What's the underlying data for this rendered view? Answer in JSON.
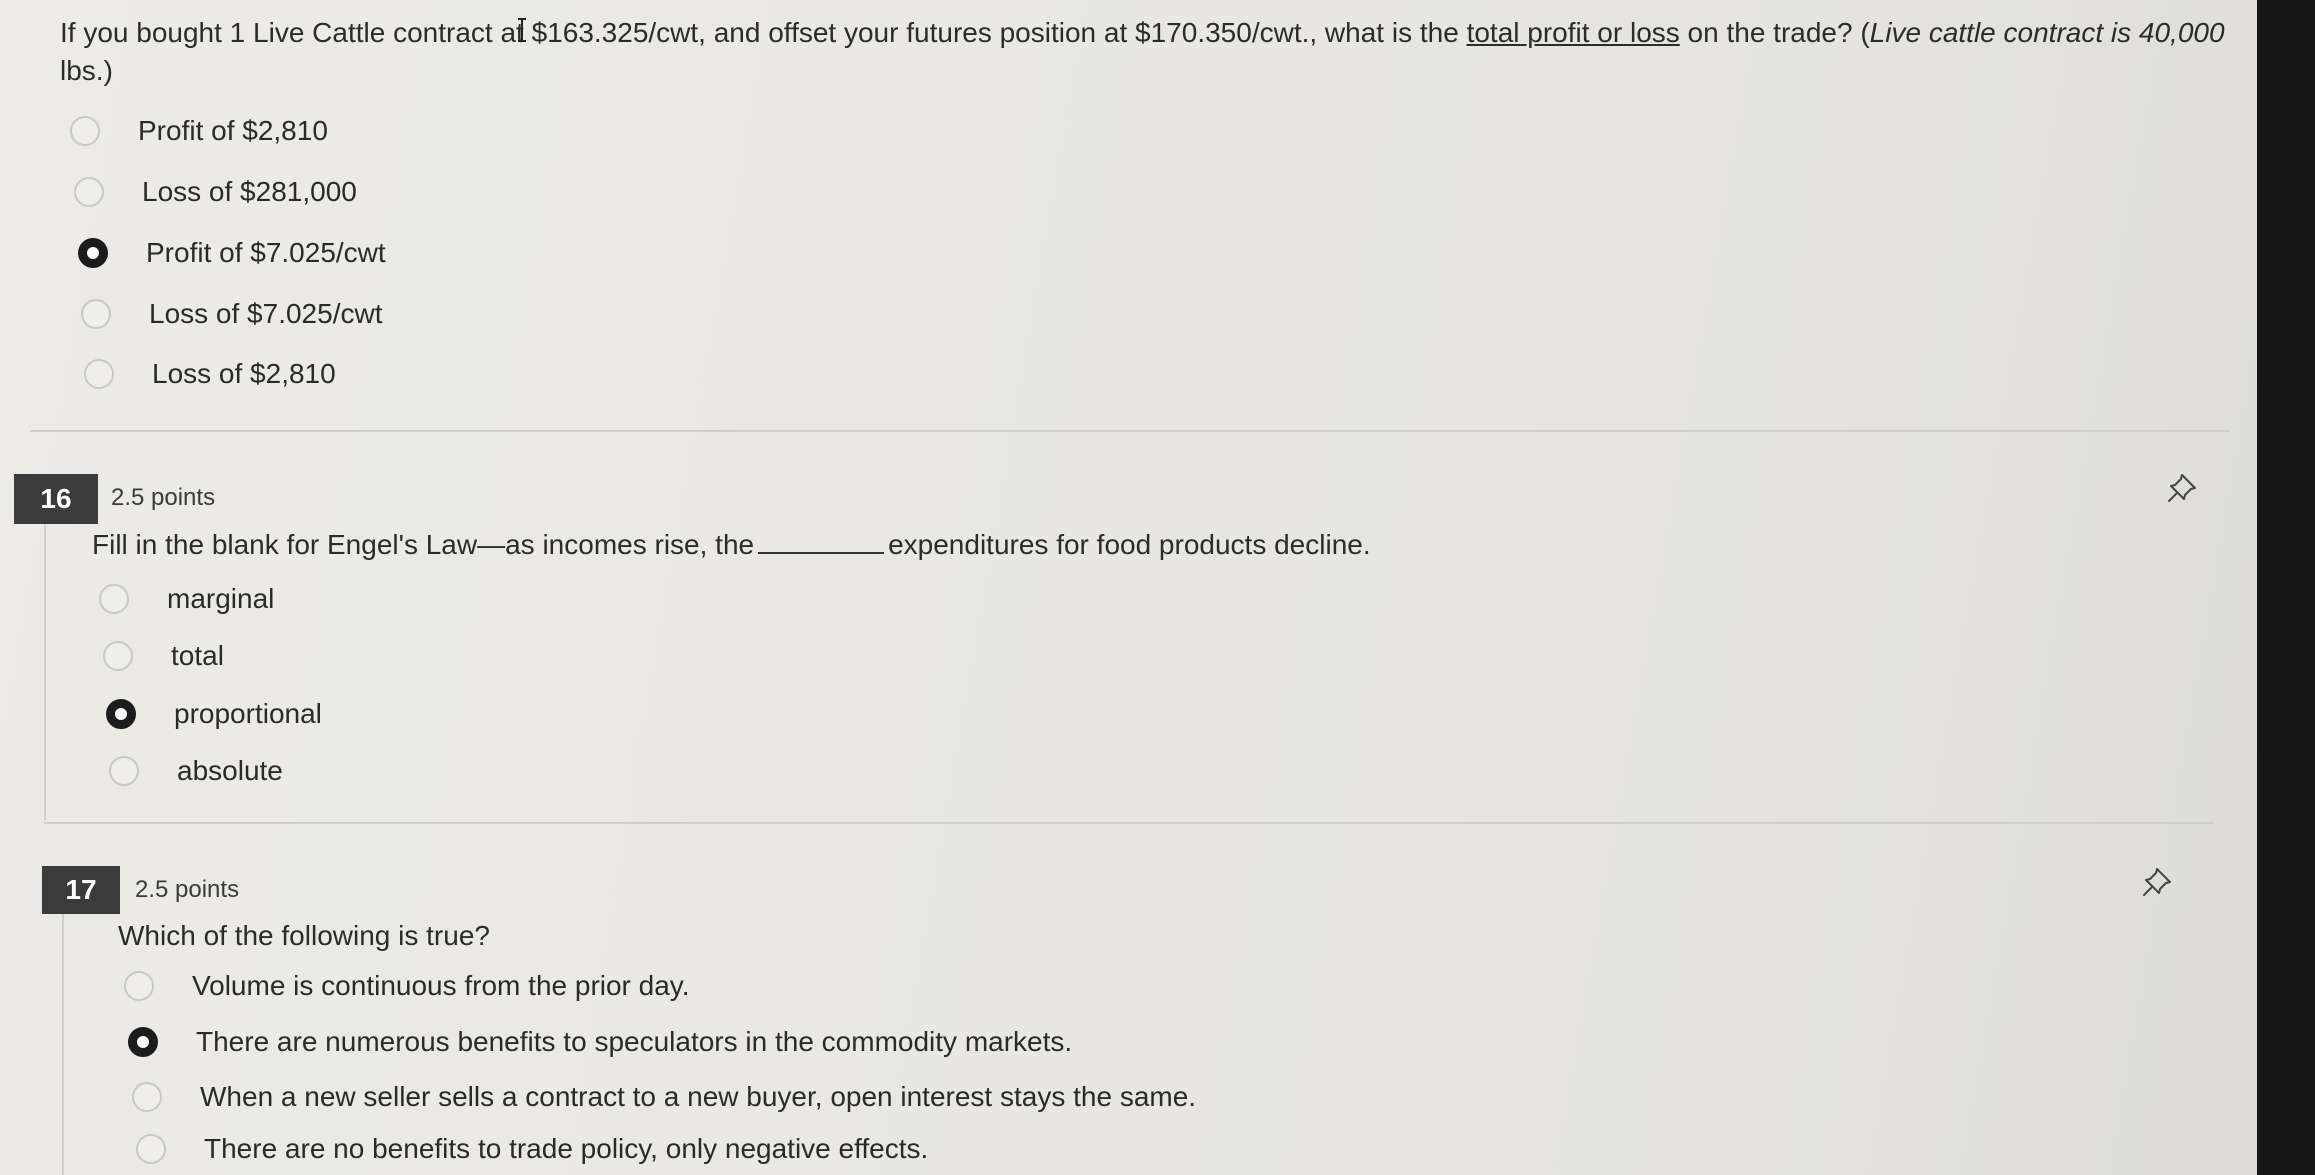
{
  "q15": {
    "text_before": "If you bought 1 Live Cattle contract at $163.325/cwt, and offset your futures position at $170.350/cwt., what is the ",
    "text_underlined": "total profit or loss",
    "text_after": " on the trade? (",
    "text_italic": "Live cattle contract is 40,000",
    "text_line2": "lbs.)",
    "options": [
      {
        "label": "Profit of $2,810",
        "selected": false
      },
      {
        "label": "Loss of $281,000",
        "selected": false
      },
      {
        "label": "Profit of $7.025/cwt",
        "selected": true
      },
      {
        "label": "Loss of $7.025/cwt",
        "selected": false
      },
      {
        "label": "Loss of $2,810",
        "selected": false
      }
    ]
  },
  "q16": {
    "number": "16",
    "points": "2.5 points",
    "text_before": "Fill in the blank for Engel's Law—as incomes rise, the",
    "text_after": "expenditures for food products decline.",
    "options": [
      {
        "label": "marginal",
        "selected": false
      },
      {
        "label": "total",
        "selected": false
      },
      {
        "label": "proportional",
        "selected": true
      },
      {
        "label": "absolute",
        "selected": false
      }
    ]
  },
  "q17": {
    "number": "17",
    "points": "2.5 points",
    "text": "Which of the following is true?",
    "options": [
      {
        "label": "Volume is continuous from the prior day.",
        "selected": false
      },
      {
        "label": "There are numerous benefits to speculators in the commodity markets.",
        "selected": true
      },
      {
        "label": "When a new seller sells a contract to a new buyer, open interest stays the same.",
        "selected": false
      },
      {
        "label": "There are no benefits to trade policy, only negative effects.",
        "selected": false
      }
    ]
  },
  "icons": {
    "pin": "pin-icon",
    "radio_selected": "radio-selected-icon",
    "radio_empty": "radio-empty-icon"
  }
}
